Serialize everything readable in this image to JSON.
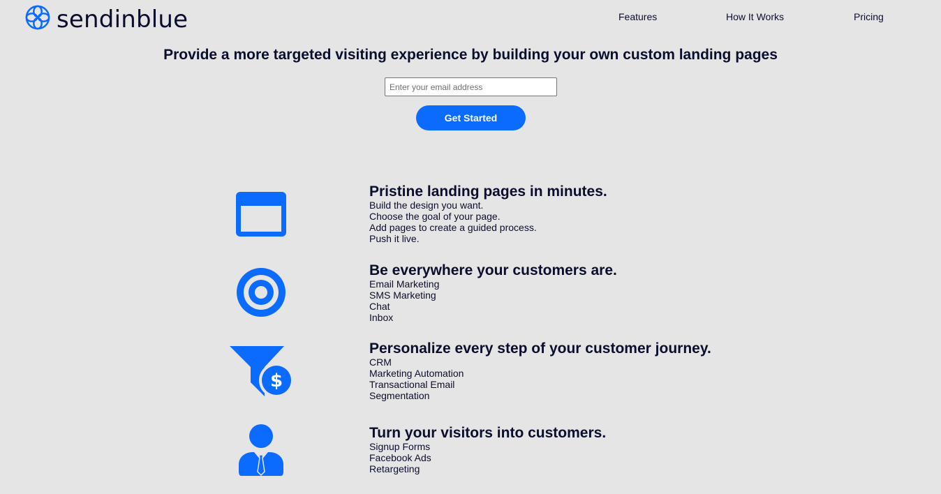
{
  "brand": {
    "name": "sendinblue",
    "accent_color": "#0b6bff",
    "text_color": "#0b0d2c",
    "background": "#e5e5e5"
  },
  "nav": {
    "items": [
      {
        "label": "Features"
      },
      {
        "label": "How It Works"
      },
      {
        "label": "Pricing"
      }
    ]
  },
  "hero": {
    "headline": "Provide a more targeted visiting experience by building your own custom landing pages",
    "email_placeholder": "Enter your email address",
    "cta_label": "Get Started"
  },
  "features": [
    {
      "icon": "browser-window-icon",
      "title": "Pristine landing pages in minutes.",
      "items": [
        "Build the design you want.",
        "Choose the goal of your page.",
        "Add pages to create a guided process.",
        "Push it live."
      ]
    },
    {
      "icon": "target-icon",
      "title": "Be everywhere your customers are.",
      "items": [
        "Email Marketing",
        "SMS Marketing",
        "Chat",
        "Inbox"
      ]
    },
    {
      "icon": "funnel-dollar-icon",
      "title": "Personalize every step of your customer journey.",
      "items": [
        "CRM",
        "Marketing Automation",
        "Transactional Email",
        "Segmentation"
      ]
    },
    {
      "icon": "user-tie-icon",
      "title": "Turn your visitors into customers.",
      "items": [
        "Signup Forms",
        "Facebook Ads",
        "Retargeting"
      ]
    }
  ]
}
